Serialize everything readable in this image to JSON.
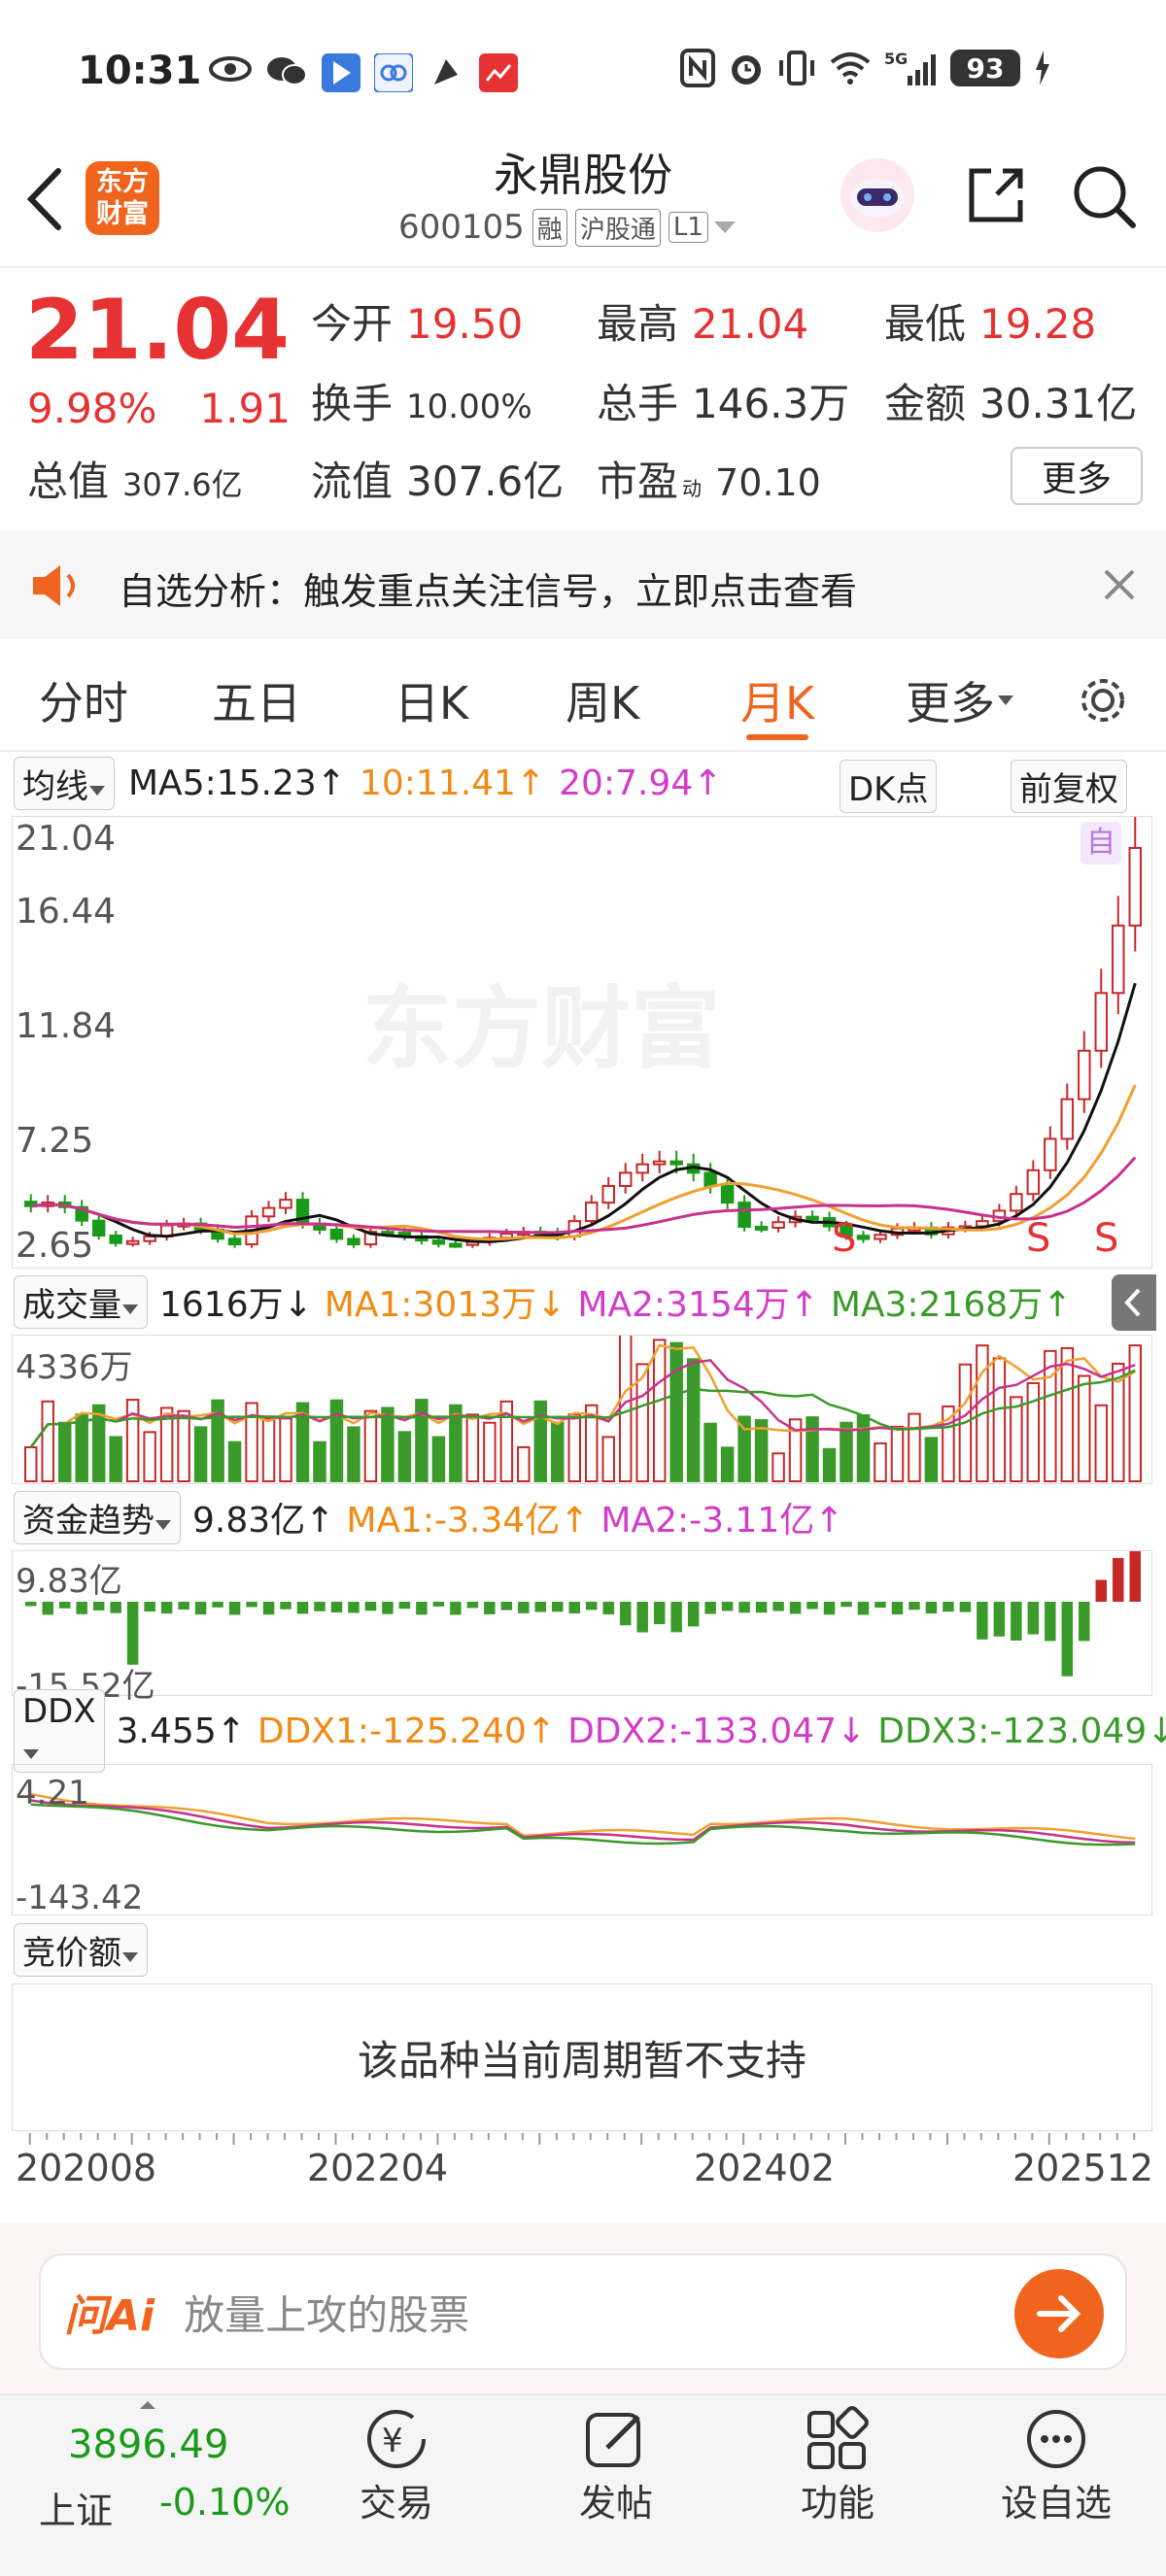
{
  "status": {
    "time": "10:31",
    "battery": "93"
  },
  "header": {
    "title": "永鼎股份",
    "code": "600105",
    "tags": [
      "融",
      "沪股通",
      "L1"
    ],
    "logo": [
      "东方",
      "财富"
    ]
  },
  "quote": {
    "price": "21.04",
    "pct": "9.98%",
    "chg": "1.91",
    "open_l": "今开",
    "open": "19.50",
    "high_l": "最高",
    "high": "21.04",
    "low_l": "最低",
    "low": "19.28",
    "turnover_l": "换手",
    "turnover": "10.00%",
    "vol_l": "总手",
    "vol": "146.3万",
    "amt_l": "金额",
    "amt": "30.31亿",
    "mcap_l": "总值",
    "mcap": "307.6亿",
    "float_l": "流值",
    "float": "307.6亿",
    "pe_l": "市盈",
    "pe_sup": "动",
    "pe": "70.10",
    "more": "更多"
  },
  "notice": {
    "text": "自选分析：触发重点关注信号，立即点击查看"
  },
  "tabs": [
    "分时",
    "五日",
    "日K",
    "周K",
    "月K",
    "更多"
  ],
  "active_tab": 4,
  "ma_bar": {
    "sel": "均线",
    "ma5": "MA5:15.23↑",
    "ma10": "10:11.41↑",
    "ma20": "20:7.94↑",
    "dk": "DK点",
    "fq": "前复权"
  },
  "kline": {
    "ticks": [
      "21.04",
      "16.44",
      "11.84",
      "7.25",
      "2.65"
    ],
    "watermark": "东方财富",
    "self_mark": "自",
    "s_marks": [
      "S",
      "S",
      "S"
    ]
  },
  "vol_bar": {
    "sel": "成交量",
    "val": "1616万↓",
    "ma1": "MA1:3013万↓",
    "ma2": "MA2:3154万↑",
    "ma3": "MA3:2168万↑",
    "top": "4336万"
  },
  "fund_bar": {
    "sel": "资金趋势",
    "val": "9.83亿↑",
    "ma1": "MA1:-3.34亿↑",
    "ma2": "MA2:-3.11亿↑",
    "top": "9.83亿",
    "bot": "-15.52亿"
  },
  "ddx_bar": {
    "sel": "DDX",
    "val": "3.455↑",
    "d1": "DDX1:-125.240↑",
    "d2": "DDX2:-133.047↓",
    "d3": "DDX3:-123.049↓",
    "top": "4.21",
    "bot": "-143.42"
  },
  "auction": {
    "sel": "竞价额",
    "msg": "该品种当前周期暂不支持"
  },
  "xaxis": [
    "202008",
    "202204",
    "202402",
    "202512"
  ],
  "ai": {
    "brand": "问Ai",
    "placeholder": "放量上攻的股票"
  },
  "bottom": {
    "index_val": "3896.49",
    "index_name": "上证",
    "index_pct": "-0.10%",
    "items": [
      "交易",
      "发帖",
      "功能",
      "设自选"
    ]
  },
  "colors": {
    "up": "#e63232",
    "down": "#1a9a1a",
    "accent": "#f0641e"
  }
}
